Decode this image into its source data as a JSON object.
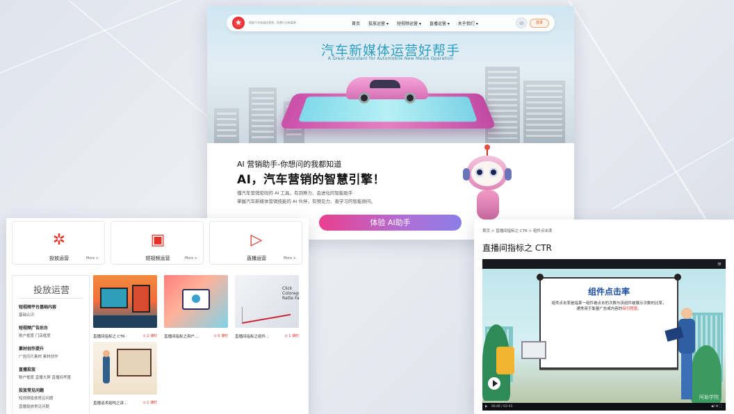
{
  "top_site": {
    "slogan": "赋能汽车新媒体营销，智慧行业新篇章",
    "nav": [
      "首页",
      "投放运营 ▾",
      "短视频运营 ▾",
      "直播运营 ▾",
      "关于我们 ▾"
    ],
    "login_label": "登录",
    "hero_title": "汽车新媒体运营好帮手",
    "hero_subtitle": "A Great Assistant for Automobile New Media Operation",
    "ai_heading": "AI 营销助手-你想问的我都知道",
    "ai_tagline": "AI，汽车营销的智慧引擎！",
    "ai_desc_1": "懂汽车营销密码的 AI 工具，有洞察力、会进化的智能助手",
    "ai_desc_2": "掌握汽车新媒体营销技能的 AI 伙伴，有预见力、善学习的智能顾问。",
    "cta_label": "体验 AI助手"
  },
  "course_site": {
    "categories": [
      {
        "label": "投放运营",
        "more": "More +",
        "icon": "network-icon"
      },
      {
        "label": "短视频运营",
        "more": "More +",
        "icon": "video-clip-icon"
      },
      {
        "label": "直播运营",
        "more": "More +",
        "icon": "tv-icon"
      }
    ],
    "sidebar_title": "投放运营",
    "sections": [
      {
        "title": "短视频平台基础内容",
        "items": "基础认识"
      },
      {
        "title": "短视频广告后台",
        "items": "账户框度    门店框度"
      },
      {
        "title": "素材创作提升",
        "items": "广告历片素材    素材创作"
      },
      {
        "title": "直播投放",
        "items": "账户框度    直播大屏    直播间考置"
      },
      {
        "title": "投放常见问题",
        "items": "短视频投放常见问题"
      },
      {
        "title": "",
        "items": "直播投放常见问题"
      }
    ],
    "courses": [
      {
        "title": "直播间指标之 CTR",
        "count": "⊙ 2 课时"
      },
      {
        "title": "直播间指标之用户...",
        "count": "⊙ 0 课时"
      },
      {
        "title": "直播间指标之组件...",
        "count": "⊙ 1 课时"
      },
      {
        "title": "直播话术结构之讲...",
        "count": "⊙ 1 课时"
      }
    ]
  },
  "video_page": {
    "breadcrumb": "首页  >  直播间指标之 CTR  >  组件点击率",
    "title": "直播间指标之 CTR",
    "board_title": "组件点击率",
    "board_text_1": "组件点击率是指某一组件被点击的次数与该组件被展示次数的比率，通常用于衡量广告或内容的",
    "board_text_highlight": "吸引程度",
    "board_text_end": "。",
    "time": "00:46 / 02:43",
    "watermark": "阿勒学院",
    "controls_right": "◀)  ⚙  ⛶"
  }
}
